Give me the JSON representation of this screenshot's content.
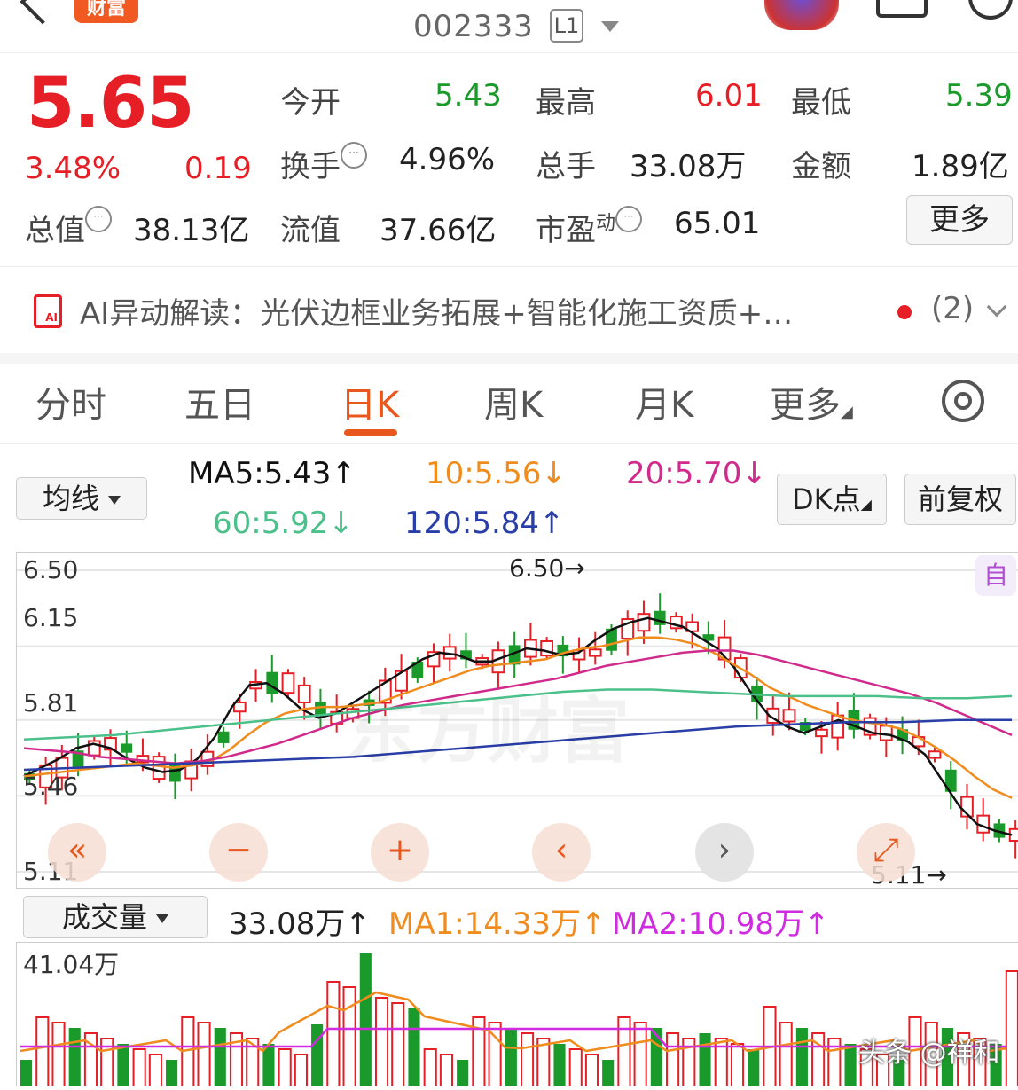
{
  "header": {
    "logo_text": "财富",
    "stock_code": "002333",
    "level_badge": "L1"
  },
  "quote": {
    "price": "5.65",
    "change_pct": "3.48%",
    "change": "0.19",
    "open_label": "今开",
    "open": "5.43",
    "high_label": "最高",
    "high": "6.01",
    "low_label": "最低",
    "low": "5.39",
    "turnover_label": "换手",
    "turnover": "4.96%",
    "volume_label": "总手",
    "volume": "33.08万",
    "amount_label": "金额",
    "amount": "1.89亿",
    "mktcap_label": "总值",
    "mktcap": "38.13亿",
    "float_label": "流值",
    "float_cap": "37.66亿",
    "pe_label": "市盈",
    "pe_sup": "动",
    "pe": "65.01",
    "more_label": "更多"
  },
  "ai": {
    "label": "AI异动解读：",
    "text": "光伏边框业务拓展+智能化施工资质+…",
    "count": "(2)"
  },
  "tabs": [
    "分时",
    "五日",
    "日K",
    "周K",
    "月K",
    "更多"
  ],
  "controls": {
    "ma_select": "均线",
    "ma5": "MA5:5.43↑",
    "ma10": "10:5.56↓",
    "ma20": "20:5.70↓",
    "ma60": "60:5.92↓",
    "ma120": "120:5.84↑",
    "dk_button": "DK点",
    "adjust_button": "前复权"
  },
  "kchart_labels": {
    "y1": "6.50",
    "y2": "6.15",
    "y3": "5.81",
    "y4": "5.46",
    "y5": "5.11",
    "high_mark": "6.50→",
    "low_mark": "5.11→",
    "auto_flag": "自"
  },
  "watermark": "东方财富",
  "volume": {
    "select": "成交量",
    "vol": "33.08万↑",
    "ma1": "MA1:14.33万↑",
    "ma2": "MA2:10.98万↑",
    "ymax": "41.04万"
  },
  "colors": {
    "up": "#e61e25",
    "down": "#1a9a2a",
    "ma5": "#111111",
    "ma10": "#f08c1e",
    "ma20": "#d02b8c",
    "ma60": "#4cc08a",
    "ma120": "#2a3ea8"
  },
  "credit": "头条 @祥和",
  "chart_data": {
    "type": "candlestick",
    "ylim": [
      5.11,
      6.5
    ],
    "yticks": [
      6.5,
      6.15,
      5.81,
      5.46,
      5.11
    ],
    "series": [
      {
        "name": "MA5",
        "values": [
          5.55,
          5.59,
          5.63,
          5.68,
          5.7,
          5.68,
          5.63,
          5.59,
          5.57,
          5.58,
          5.63,
          5.73,
          5.87,
          5.97,
          5.98,
          5.93,
          5.86,
          5.82,
          5.84,
          5.89,
          5.94,
          5.99,
          6.04,
          6.09,
          6.12,
          6.11,
          6.08,
          6.08,
          6.11,
          6.14,
          6.13,
          6.11,
          6.12,
          6.18,
          6.23,
          6.26,
          6.28,
          6.26,
          6.24,
          6.19,
          6.14,
          6.05,
          5.93,
          5.83,
          5.78,
          5.75,
          5.78,
          5.81,
          5.78,
          5.75,
          5.74,
          5.71,
          5.65,
          5.53,
          5.41,
          5.33,
          5.3,
          5.28
        ]
      },
      {
        "name": "MA10",
        "values": [
          5.55,
          5.56,
          5.57,
          5.58,
          5.59,
          5.6,
          5.61,
          5.6,
          5.59,
          5.6,
          5.62,
          5.67,
          5.74,
          5.8,
          5.84,
          5.86,
          5.87,
          5.87,
          5.88,
          5.89,
          5.92,
          5.95,
          5.98,
          6.01,
          6.04,
          6.06,
          6.07,
          6.08,
          6.09,
          6.12,
          6.14,
          6.15,
          6.17,
          6.19,
          6.19,
          6.18,
          6.16,
          6.12,
          6.07,
          6.02,
          5.96,
          5.92,
          5.88,
          5.85,
          5.82,
          5.8,
          5.79,
          5.77,
          5.73,
          5.68,
          5.62,
          5.55,
          5.49,
          5.45
        ]
      },
      {
        "name": "MA20",
        "values": [
          5.68,
          5.67,
          5.66,
          5.64,
          5.63,
          5.62,
          5.61,
          5.62,
          5.64,
          5.67,
          5.7,
          5.74,
          5.78,
          5.82,
          5.85,
          5.88,
          5.9,
          5.92,
          5.94,
          5.96,
          5.98,
          6.0,
          6.03,
          6.06,
          6.08,
          6.1,
          6.12,
          6.13,
          6.13,
          6.11,
          6.08,
          6.05,
          6.02,
          5.99,
          5.96,
          5.93,
          5.89,
          5.84,
          5.79,
          5.74
        ]
      },
      {
        "name": "MA60",
        "values": [
          5.72,
          5.73,
          5.74,
          5.76,
          5.78,
          5.8,
          5.82,
          5.84,
          5.86,
          5.88,
          5.9,
          5.92,
          5.94,
          5.95,
          5.95,
          5.94,
          5.93,
          5.92,
          5.92,
          5.92,
          5.91,
          5.91,
          5.92
        ]
      },
      {
        "name": "MA120",
        "values": [
          5.58,
          5.59,
          5.6,
          5.61,
          5.62,
          5.63,
          5.64,
          5.66,
          5.68,
          5.7,
          5.72,
          5.74,
          5.76,
          5.78,
          5.79,
          5.8,
          5.8,
          5.81,
          5.81
        ]
      }
    ]
  }
}
